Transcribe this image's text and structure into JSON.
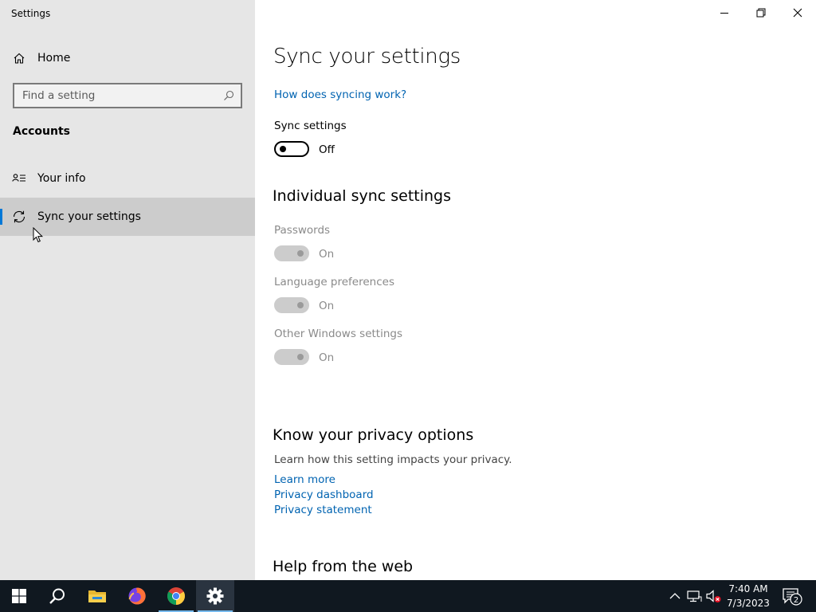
{
  "window": {
    "title": "Settings"
  },
  "sidebar": {
    "home_label": "Home",
    "search_placeholder": "Find a setting",
    "section_heading": "Accounts",
    "items": [
      {
        "label": "Your info",
        "icon": "person-list-icon"
      },
      {
        "label": "Sync your settings",
        "icon": "sync-icon",
        "selected": true
      }
    ]
  },
  "main": {
    "title": "Sync your settings",
    "help_link": "How does syncing work?",
    "sync": {
      "label": "Sync settings",
      "state": "Off"
    },
    "individual": {
      "heading": "Individual sync settings",
      "items": [
        {
          "label": "Passwords",
          "state": "On",
          "disabled": true
        },
        {
          "label": "Language preferences",
          "state": "On",
          "disabled": true
        },
        {
          "label": "Other Windows settings",
          "state": "On",
          "disabled": true
        }
      ]
    },
    "privacy": {
      "heading": "Know your privacy options",
      "description": "Learn how this setting impacts your privacy.",
      "links": [
        "Learn more",
        "Privacy dashboard",
        "Privacy statement"
      ]
    },
    "help": {
      "heading": "Help from the web"
    }
  },
  "taskbar": {
    "time": "7:40 AM",
    "date": "7/3/2023",
    "notification_count": "2",
    "apps": [
      "start-icon",
      "search-icon",
      "file-explorer-icon",
      "firefox-icon",
      "chrome-icon",
      "settings-icon"
    ]
  },
  "colors": {
    "accent": "#0078d7",
    "link": "#0063b1",
    "sidebar_bg": "#e6e6e6",
    "taskbar_bg": "#101820"
  }
}
